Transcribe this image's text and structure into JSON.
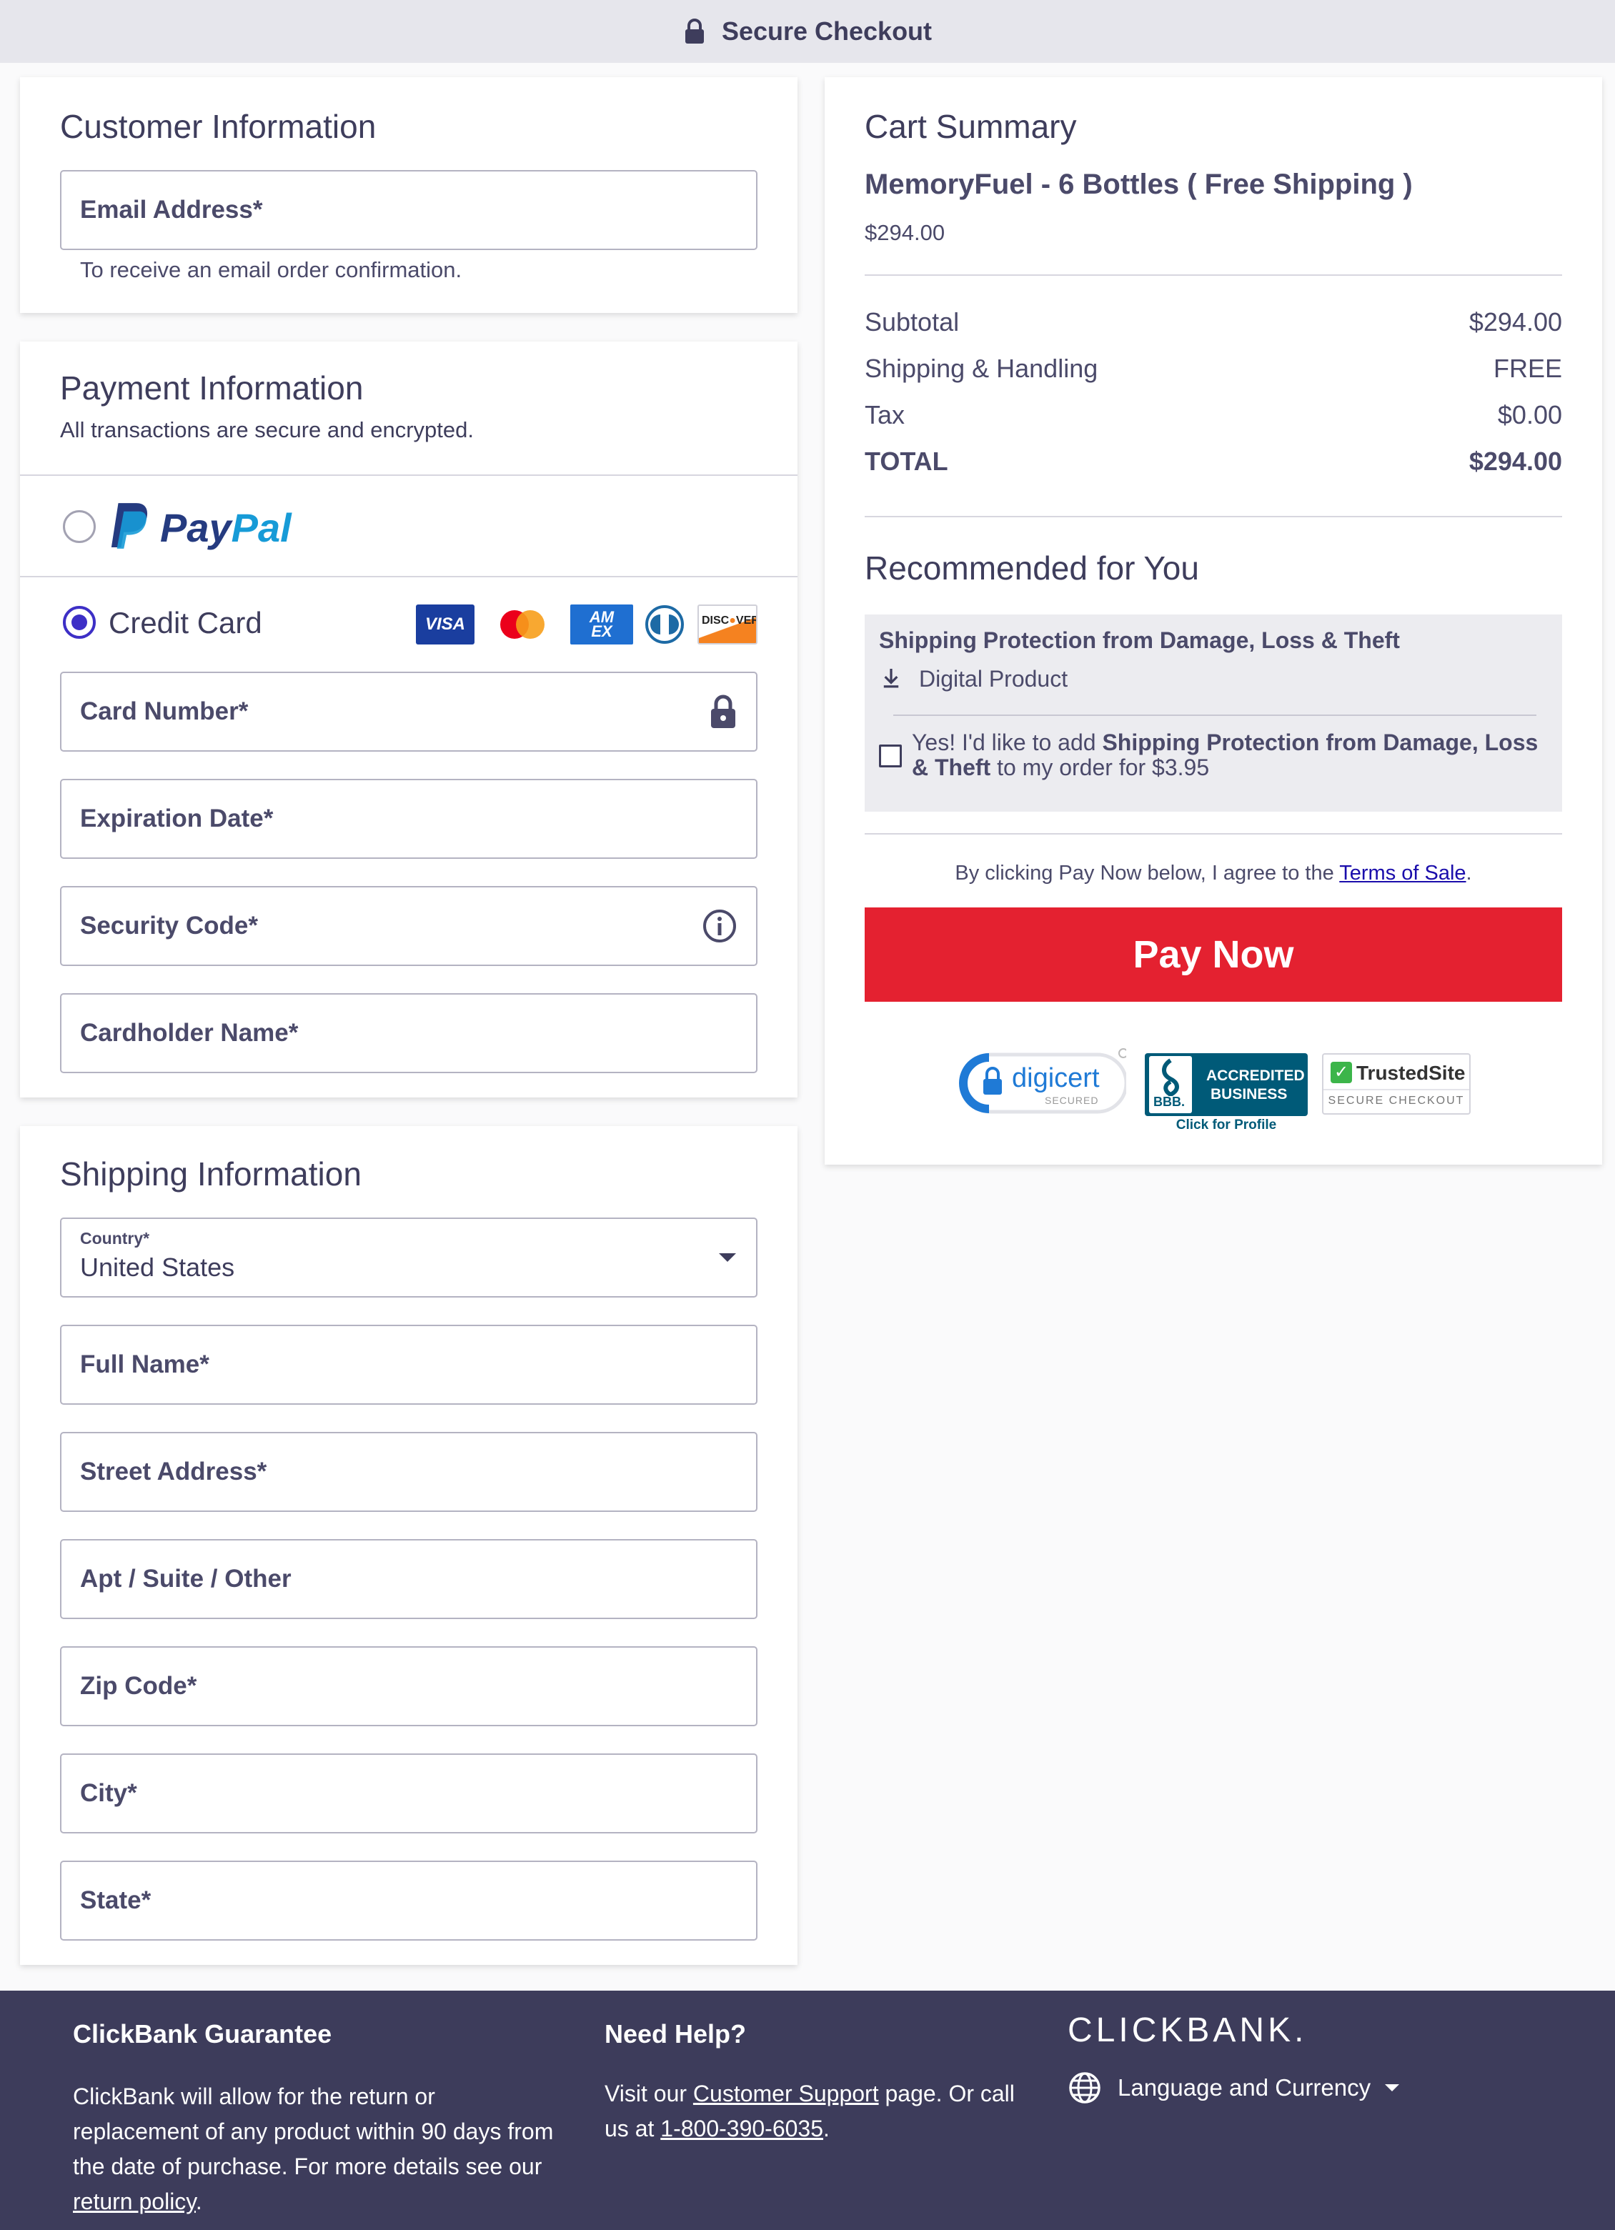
{
  "header": {
    "title": "Secure Checkout"
  },
  "customer": {
    "title": "Customer Information",
    "email_placeholder": "Email Address*",
    "email_helper": "To receive an email order confirmation."
  },
  "payment": {
    "title": "Payment Information",
    "subtitle": "All transactions are secure and encrypted.",
    "paypal_label": "PayPal",
    "credit_card_label": "Credit Card",
    "card_logos": [
      "VISA",
      "Mastercard",
      "AMEX",
      "Diners",
      "DISCOVER"
    ],
    "card_number": "Card Number*",
    "expiration": "Expiration Date*",
    "security_code": "Security Code*",
    "cardholder": "Cardholder Name*"
  },
  "shipping": {
    "title": "Shipping Information",
    "country_label": "Country*",
    "country_value": "United States",
    "full_name": "Full Name*",
    "street": "Street Address*",
    "apt": "Apt / Suite / Other",
    "zip": "Zip Code*",
    "city": "City*",
    "state": "State*"
  },
  "cart": {
    "title": "Cart Summary",
    "product_name": "MemoryFuel - 6 Bottles ( Free Shipping )",
    "product_price": "$294.00",
    "rows": [
      {
        "label": "Subtotal",
        "value": "$294.00"
      },
      {
        "label": "Shipping & Handling",
        "value": "FREE"
      },
      {
        "label": "Tax",
        "value": "$0.00"
      },
      {
        "label": "TOTAL",
        "value": "$294.00"
      }
    ]
  },
  "recommended": {
    "title": "Recommended for You",
    "item_title": "Shipping Protection from Damage, Loss & Theft",
    "item_type": "Digital Product",
    "offer_prefix": "Yes! I'd like to add ",
    "offer_bold": "Shipping Protection from Damage, Loss & Theft",
    "offer_suffix": " to my order for $3.95"
  },
  "terms": {
    "prefix": "By clicking Pay Now below, I agree to the ",
    "link": "Terms of Sale",
    "suffix": "."
  },
  "pay_button": "Pay Now",
  "badges": {
    "digicert": "digicert",
    "digicert_sub": "SECURED",
    "bbb_line1": "ACCREDITED",
    "bbb_line2": "BUSINESS",
    "bbb_logo": "BBB.",
    "bbb_caption": "Click for Profile",
    "trusted": "TrustedSite",
    "trusted_sub": "SECURE CHECKOUT"
  },
  "footer": {
    "guarantee_title": "ClickBank Guarantee",
    "guarantee_text": "ClickBank will allow for the return or replacement of any product within 90 days from the date of purchase. For more details see our ",
    "guarantee_link": "return policy",
    "guarantee_end": ".",
    "help_title": "Need Help?",
    "help_prefix": "Visit our ",
    "help_link": "Customer Support",
    "help_mid": " page. Or call us at ",
    "help_phone": "1-800-390-6035",
    "help_end": ".",
    "brand": "CLICKBANK.",
    "language": "Language and Currency"
  },
  "colors": {
    "accent": "#3d2fc6",
    "pay_button": "#e42130",
    "footer": "#3d3c5b"
  }
}
